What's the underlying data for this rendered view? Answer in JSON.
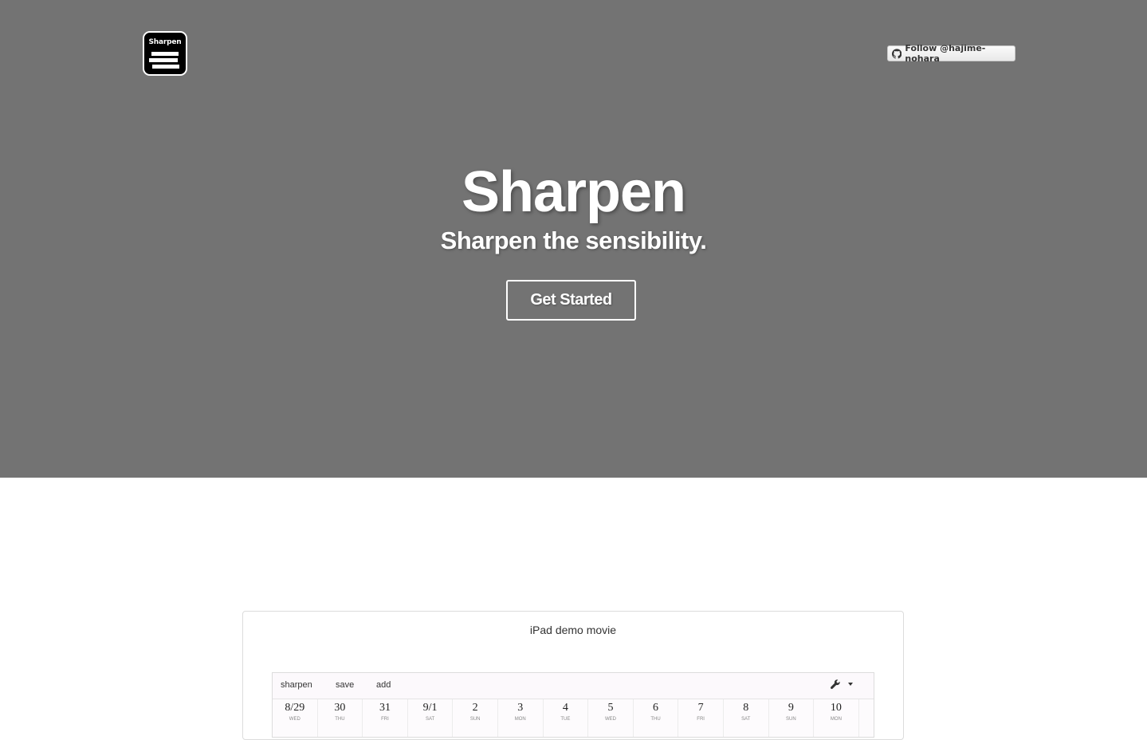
{
  "header": {
    "logo_text": "Sharpen",
    "follow_label": "Follow @hajime-nohara"
  },
  "hero": {
    "title": "Sharpen",
    "subtitle": "Sharpen the sensibility.",
    "cta_label": "Get Started"
  },
  "demo": {
    "title": "iPad demo movie",
    "toolbar": {
      "sharpen_label": "sharpen",
      "save_label": "save",
      "add_label": "add",
      "settings_icon": "wrench-icon"
    },
    "dates": [
      {
        "num": "8/29",
        "dow": "WED"
      },
      {
        "num": "30",
        "dow": "THU"
      },
      {
        "num": "31",
        "dow": "FRI"
      },
      {
        "num": "9/1",
        "dow": "SAT"
      },
      {
        "num": "2",
        "dow": "SUN"
      },
      {
        "num": "3",
        "dow": "MON"
      },
      {
        "num": "4",
        "dow": "TUE"
      },
      {
        "num": "5",
        "dow": "WED"
      },
      {
        "num": "6",
        "dow": "THU"
      },
      {
        "num": "7",
        "dow": "FRI"
      },
      {
        "num": "8",
        "dow": "SAT"
      },
      {
        "num": "9",
        "dow": "SUN"
      },
      {
        "num": "10",
        "dow": "MON"
      }
    ]
  },
  "colors": {
    "hero_bg": "#737373",
    "text_light": "#ffffff"
  }
}
